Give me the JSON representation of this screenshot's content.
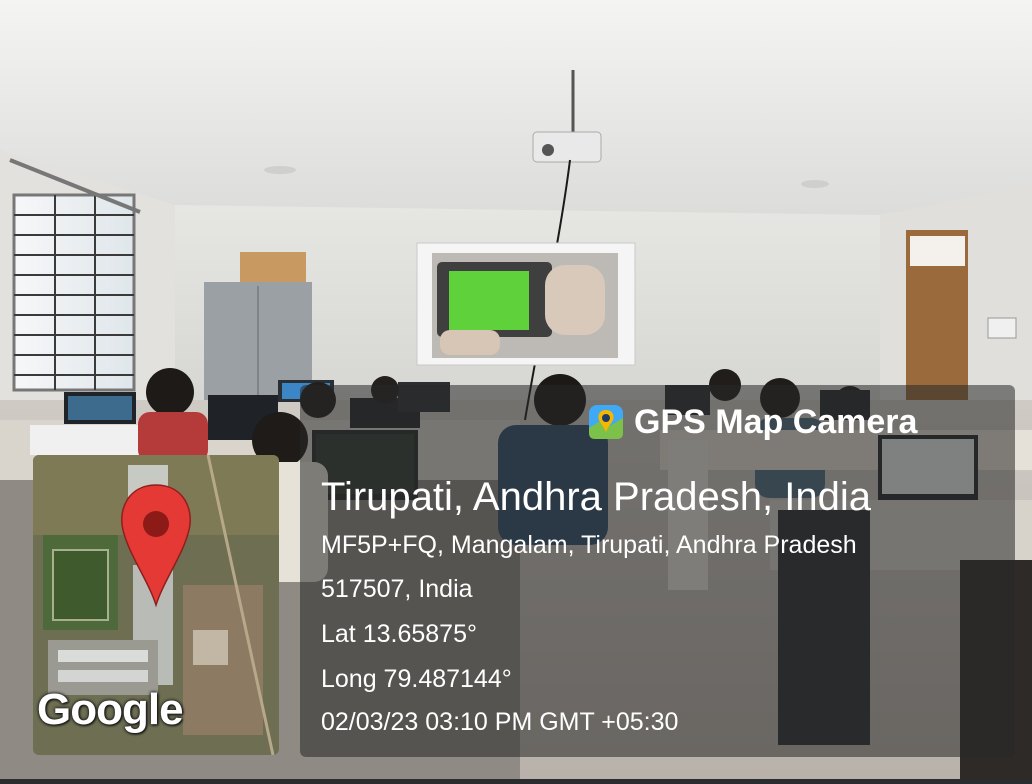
{
  "overlay": {
    "app_name": "GPS Map Camera",
    "app_icon": "map-pin-camera-icon",
    "location_title": "Tirupati, Andhra Pradesh, India",
    "address_line1": "MF5P+FQ, Mangalam, Tirupati, Andhra Pradesh",
    "address_line2": "517507, India",
    "latitude": "Lat 13.65875°",
    "longitude": "Long 79.487144°",
    "datetime": "02/03/23 03:10 PM GMT +05:30"
  },
  "map": {
    "attribution": "Google",
    "pin_color": "#e53935",
    "pin_icon": "map-pin-icon"
  },
  "colors": {
    "screen_green": "#5fd13a",
    "wall": "#e8e8e4",
    "ceiling": "#f1f1ef"
  }
}
